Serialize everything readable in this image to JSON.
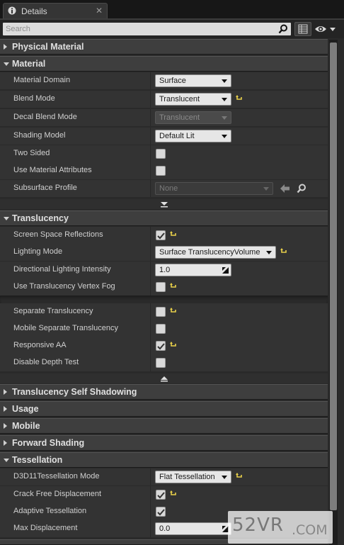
{
  "tab": {
    "title": "Details",
    "close": "✕"
  },
  "search": {
    "placeholder": "Search"
  },
  "colors": {
    "accent_reset": "#e8d04a",
    "header_bg": "#3e3e3e",
    "row_bg": "#333333"
  },
  "categories": {
    "physical_material": "Physical Material",
    "material": "Material",
    "translucency": "Translucency",
    "translucency_self_shadowing": "Translucency Self Shadowing",
    "usage": "Usage",
    "mobile": "Mobile",
    "forward_shading": "Forward Shading",
    "tessellation": "Tessellation"
  },
  "material": {
    "material_domain": {
      "label": "Material Domain",
      "value": "Surface"
    },
    "blend_mode": {
      "label": "Blend Mode",
      "value": "Translucent"
    },
    "decal_blend_mode": {
      "label": "Decal Blend Mode",
      "value": "Translucent"
    },
    "shading_model": {
      "label": "Shading Model",
      "value": "Default Lit"
    },
    "two_sided": {
      "label": "Two Sided",
      "checked": false
    },
    "use_material_attributes": {
      "label": "Use Material Attributes",
      "checked": false
    },
    "subsurface_profile": {
      "label": "Subsurface Profile",
      "value": "None"
    }
  },
  "translucency": {
    "screen_space_reflections": {
      "label": "Screen Space Reflections",
      "checked": true
    },
    "lighting_mode": {
      "label": "Lighting Mode",
      "value": "Surface TranslucencyVolume"
    },
    "directional_lighting_intensity": {
      "label": "Directional Lighting Intensity",
      "value": "1.0"
    },
    "use_translucency_vertex_fog": {
      "label": "Use Translucency Vertex Fog",
      "checked": false
    },
    "separate_translucency": {
      "label": "Separate Translucency",
      "checked": false
    },
    "mobile_separate_translucency": {
      "label": "Mobile Separate Translucency",
      "checked": false
    },
    "responsive_aa": {
      "label": "Responsive AA",
      "checked": true
    },
    "disable_depth_test": {
      "label": "Disable Depth Test",
      "checked": false
    }
  },
  "tessellation": {
    "d3d11_tessellation_mode": {
      "label": "D3D11Tessellation Mode",
      "value": "Flat Tessellation"
    },
    "crack_free_displacement": {
      "label": "Crack Free Displacement",
      "checked": true
    },
    "adaptive_tessellation": {
      "label": "Adaptive Tessellation",
      "checked": true
    },
    "max_displacement": {
      "label": "Max Displacement",
      "value": "0.0"
    }
  },
  "watermark": {
    "main": "52VR",
    "suffix": ".COM"
  }
}
